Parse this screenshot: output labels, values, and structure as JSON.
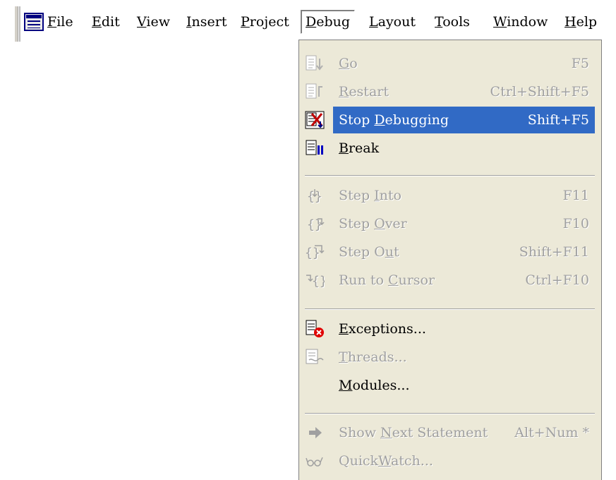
{
  "menubar": {
    "items": [
      {
        "pre": "",
        "u": "F",
        "post": "ile"
      },
      {
        "pre": "",
        "u": "E",
        "post": "dit"
      },
      {
        "pre": "",
        "u": "V",
        "post": "iew"
      },
      {
        "pre": "",
        "u": "I",
        "post": "nsert"
      },
      {
        "pre": "",
        "u": "P",
        "post": "roject"
      },
      {
        "pre": "",
        "u": "D",
        "post": "ebug"
      },
      {
        "pre": "",
        "u": "L",
        "post": "ayout"
      },
      {
        "pre": "",
        "u": "T",
        "post": "ools"
      },
      {
        "pre": "",
        "u": "W",
        "post": "indow"
      },
      {
        "pre": "",
        "u": "H",
        "post": "elp"
      }
    ]
  },
  "debug_menu": {
    "go": {
      "pre": "",
      "u": "G",
      "post": "o",
      "shortcut": "F5"
    },
    "restart": {
      "pre": "",
      "u": "R",
      "post": "estart",
      "shortcut": "Ctrl+Shift+F5"
    },
    "stop": {
      "pre": "Stop ",
      "u": "D",
      "post": "ebugging",
      "shortcut": "Shift+F5"
    },
    "break": {
      "pre": "",
      "u": "B",
      "post": "reak",
      "shortcut": ""
    },
    "step_into": {
      "pre": "Step ",
      "u": "I",
      "post": "nto",
      "shortcut": "F11"
    },
    "step_over": {
      "pre": "Step ",
      "u": "O",
      "post": "ver",
      "shortcut": "F10"
    },
    "step_out": {
      "pre": "Step O",
      "u": "u",
      "post": "t",
      "shortcut": "Shift+F11"
    },
    "run_to_cursor": {
      "pre": "Run to ",
      "u": "C",
      "post": "ursor",
      "shortcut": "Ctrl+F10"
    },
    "exceptions": {
      "pre": "",
      "u": "E",
      "post": "xceptions...",
      "shortcut": ""
    },
    "threads": {
      "pre": "",
      "u": "T",
      "post": "hreads...",
      "shortcut": ""
    },
    "modules": {
      "pre": "",
      "u": "M",
      "post": "odules...",
      "shortcut": ""
    },
    "show_next": {
      "pre": "Show ",
      "u": "N",
      "post": "ext Statement",
      "shortcut": "Alt+Num *"
    },
    "quickwatch": {
      "pre": "Quick",
      "u": "W",
      "post": "atch...",
      "shortcut": ""
    }
  },
  "colors": {
    "highlight": "#316ac5",
    "menu_bg": "#ece9d8",
    "disabled": "#a0a0a0"
  }
}
